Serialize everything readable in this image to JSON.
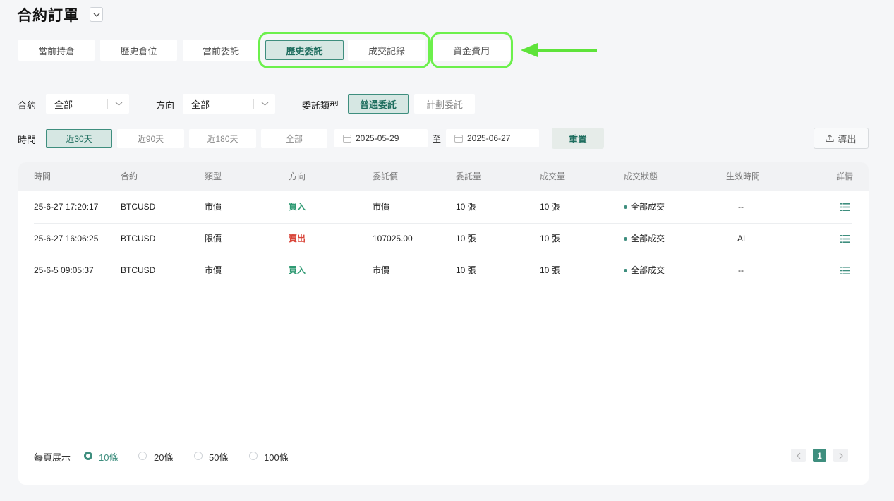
{
  "header": {
    "title": "合約訂單"
  },
  "tabs": [
    "當前持倉",
    "歷史倉位",
    "當前委託",
    "歷史委託",
    "成交記錄",
    "資金費用"
  ],
  "filters": {
    "contract_label": "合約",
    "contract_value": "全部",
    "direction_label": "方向",
    "direction_value": "全部",
    "order_type_label": "委託類型",
    "order_types": [
      "普通委託",
      "計劃委託"
    ],
    "time_label": "時間",
    "time_ranges": [
      "近30天",
      "近90天",
      "近180天",
      "全部"
    ],
    "date_from": "2025-05-29",
    "date_separator": "至",
    "date_to": "2025-06-27",
    "reset_label": "重置",
    "export_label": "導出"
  },
  "table": {
    "headers": [
      "時間",
      "合約",
      "類型",
      "方向",
      "委託價",
      "委託量",
      "成交量",
      "成交狀態",
      "生效時間",
      "詳情"
    ],
    "rows": [
      {
        "time": "25-6-27 17:20:17",
        "contract": "BTCUSD",
        "type": "市價",
        "direction": "買入",
        "price": "市價",
        "qty": "10 張",
        "filled": "10 張",
        "status": "全部成交",
        "effective": "--"
      },
      {
        "time": "25-6-27 16:06:25",
        "contract": "BTCUSD",
        "type": "限價",
        "direction": "賣出",
        "price": "107025.00",
        "qty": "10 張",
        "filled": "10 張",
        "status": "全部成交",
        "effective": "AL"
      },
      {
        "time": "25-6-5 09:05:37",
        "contract": "BTCUSD",
        "type": "市價",
        "direction": "買入",
        "price": "市價",
        "qty": "10 張",
        "filled": "10 張",
        "status": "全部成交",
        "effective": "--"
      }
    ]
  },
  "pagination": {
    "page_size_label": "每頁展示",
    "sizes": [
      "10條",
      "20條",
      "50條",
      "100條"
    ],
    "selected_size": "10條",
    "current_page": "1"
  },
  "colors": {
    "accent": "#3e8e7e",
    "buy": "#2f9a73",
    "sell": "#d9473b",
    "annotation": "#5ee33a"
  }
}
